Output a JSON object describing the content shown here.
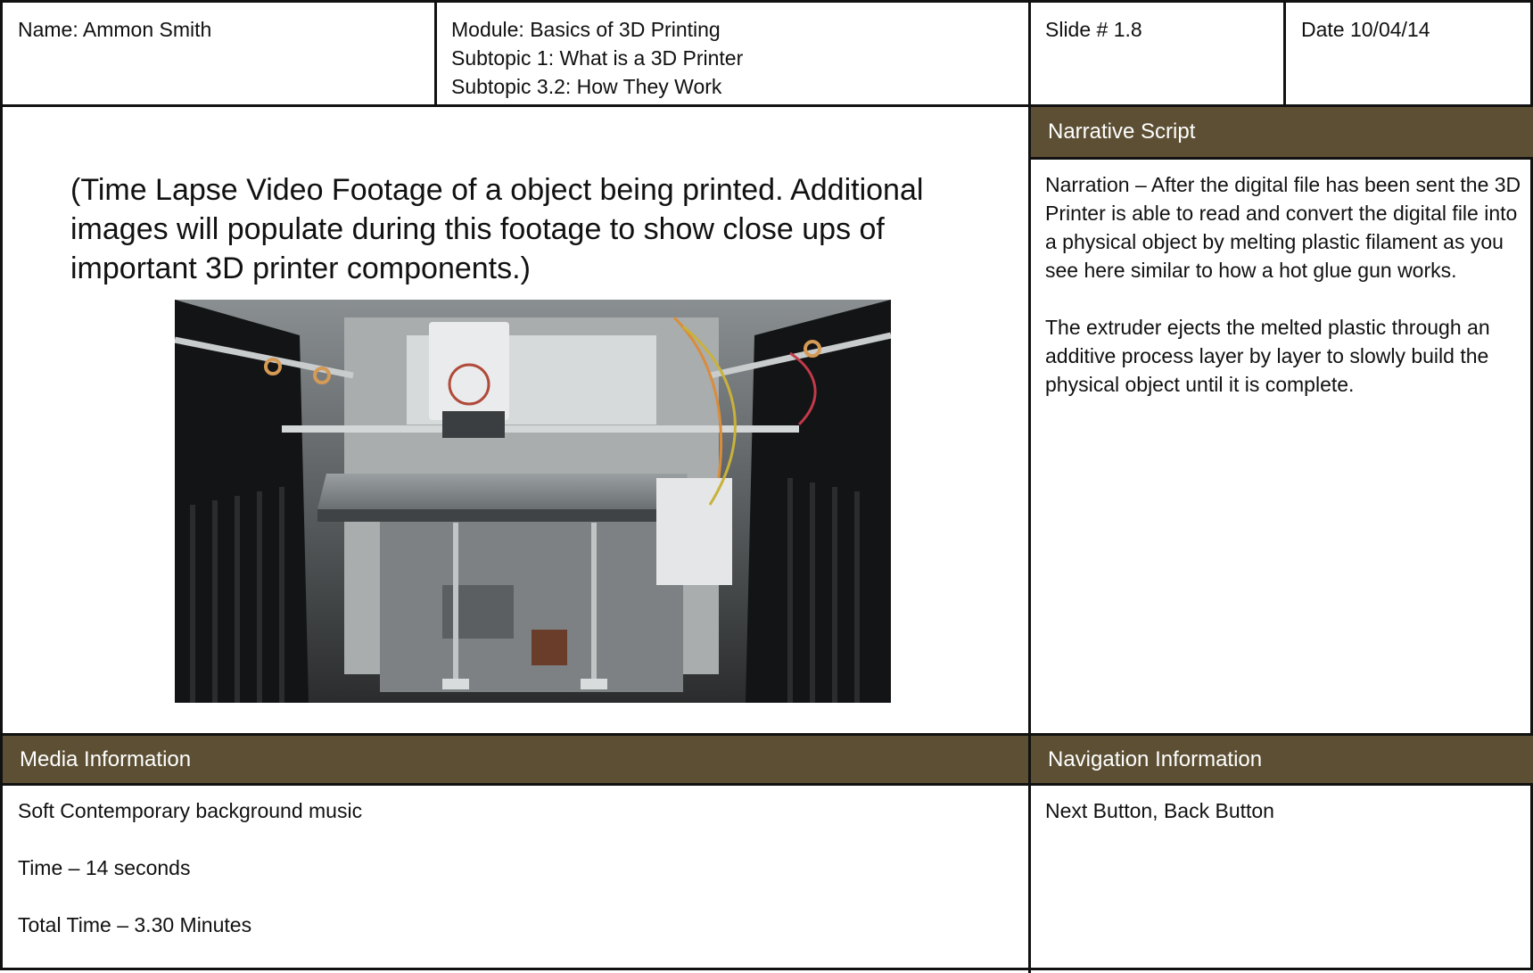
{
  "header": {
    "name": "Name: Ammon Smith",
    "module": "Module: Basics of 3D Printing",
    "subtopic1": "Subtopic 1: What is a 3D Printer",
    "subtopic2": "Subtopic 3.2: How They Work",
    "slide": "Slide # 1.8",
    "date": "Date 10/04/14"
  },
  "visual": {
    "description_text": "(Time Lapse Video Footage of a object being printed. Additional images will populate during this footage to show close ups of important 3D printer components.)"
  },
  "narrative": {
    "heading": "Narrative Script",
    "paragraph1": "Narration – After the digital file has been sent the 3D Printer is able to read and convert the digital file into a physical object by melting plastic filament as you see here similar to how a hot glue gun works.",
    "paragraph2": "The extruder ejects the melted plastic through an additive process layer by layer to slowly build the physical object until it is complete."
  },
  "media": {
    "heading": "Media Information",
    "line1": "Soft Contemporary background music",
    "line2": "Time – 14 seconds",
    "line3": "Total Time – 3.30 Minutes"
  },
  "navigation": {
    "heading": "Navigation Information",
    "line1": "Next Button, Back Button"
  },
  "colors": {
    "header_bar": "#5c4f33",
    "border": "#111111"
  }
}
